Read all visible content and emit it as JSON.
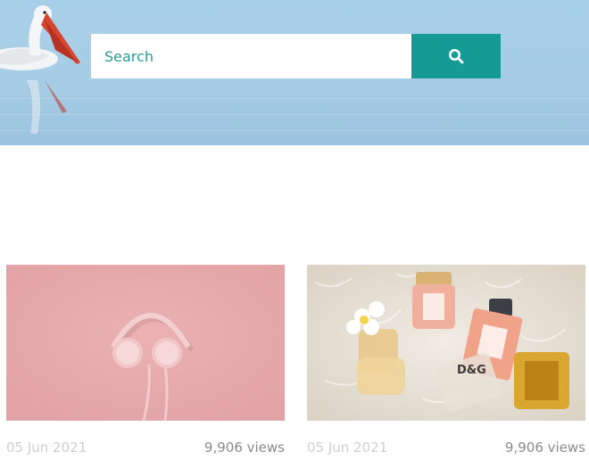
{
  "header": {
    "search": {
      "placeholder": "Search",
      "value": ""
    },
    "search_button": {
      "icon": "search-icon"
    }
  },
  "colors": {
    "accent": "#159a95",
    "hero_sky": "#a8cfe9"
  },
  "cards": [
    {
      "date": "05 Jun 2021",
      "views": "9,906 views",
      "image": "pink-headphones-photo"
    },
    {
      "date": "05 Jun 2021",
      "views": "9,906 views",
      "image": "perfume-bottles-on-fur-photo"
    }
  ]
}
